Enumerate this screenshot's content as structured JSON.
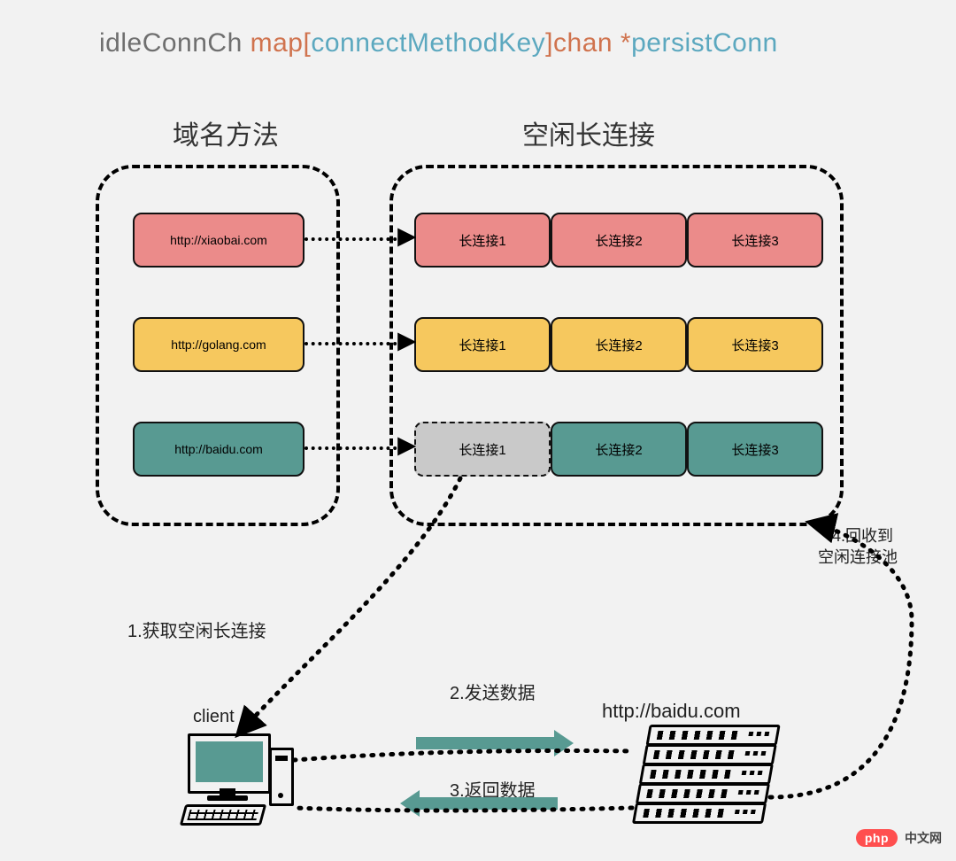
{
  "title": {
    "w1": "idleConnCh",
    "w2": "map",
    "lb": "[",
    "w3": "connectMethodKey",
    "rb": "]",
    "w4": "chan",
    "star": "*",
    "w5": "persistConn"
  },
  "headers": {
    "left": "域名方法",
    "right": "空闲长连接"
  },
  "keys": [
    {
      "label": "http://xiaobai.com",
      "color": "pink"
    },
    {
      "label": "http://golang.com",
      "color": "amber"
    },
    {
      "label": "http://baidu.com",
      "color": "teal"
    }
  ],
  "conns": {
    "row0": [
      {
        "label": "长连接1",
        "style": "pink"
      },
      {
        "label": "长连接2",
        "style": "pink"
      },
      {
        "label": "长连接3",
        "style": "pink"
      }
    ],
    "row1": [
      {
        "label": "长连接1",
        "style": "amber"
      },
      {
        "label": "长连接2",
        "style": "amber"
      },
      {
        "label": "长连接3",
        "style": "amber"
      }
    ],
    "row2": [
      {
        "label": "长连接1",
        "style": "gray-dashed"
      },
      {
        "label": "长连接2",
        "style": "teal"
      },
      {
        "label": "长连接3",
        "style": "teal"
      }
    ]
  },
  "steps": {
    "s1": "1.获取空闲长连接",
    "s2": "2.发送数据",
    "s3": "3.返回数据",
    "s4a": "4.回收到",
    "s4b": "空闲连接池"
  },
  "labels": {
    "client": "client",
    "server_url": "http://baidu.com"
  },
  "footer": {
    "brand": "php",
    "text": "中文网"
  }
}
